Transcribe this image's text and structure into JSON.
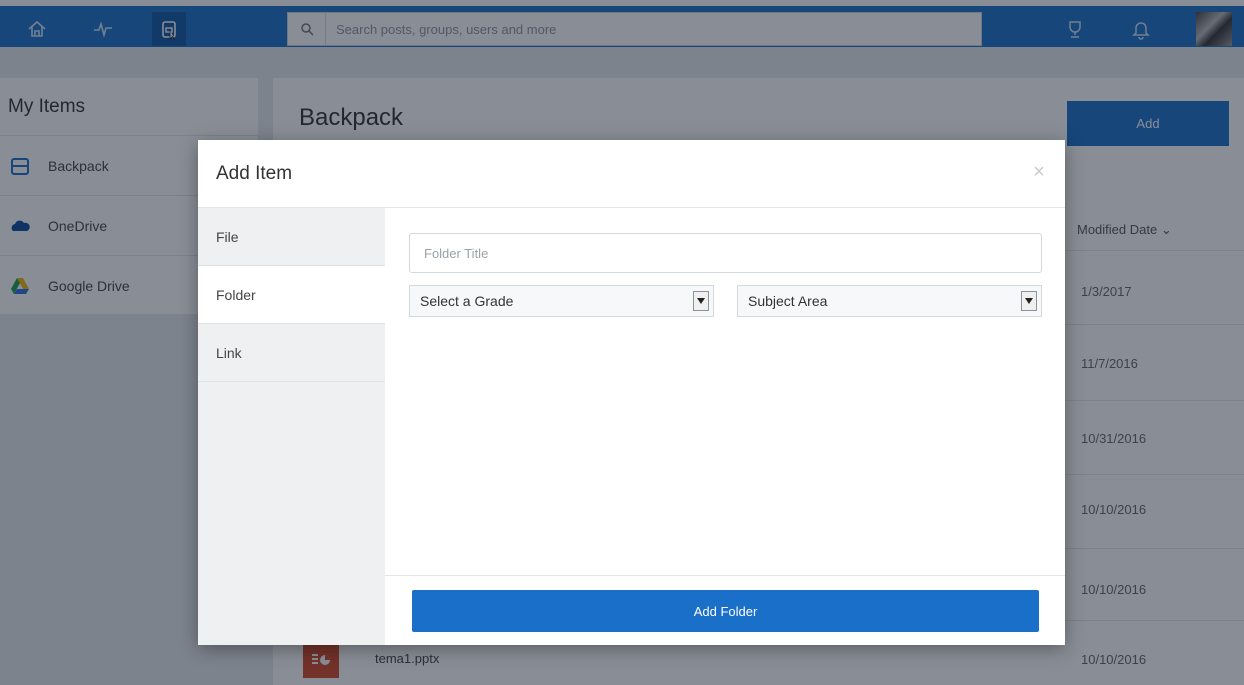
{
  "search": {
    "placeholder": "Search posts, groups, users and more"
  },
  "sidebar": {
    "title": "My Items",
    "items": [
      {
        "label": "Backpack",
        "icon": "backpack-icon"
      },
      {
        "label": "OneDrive",
        "icon": "cloud-icon"
      },
      {
        "label": "Google Drive",
        "icon": "google-drive-icon"
      }
    ]
  },
  "main": {
    "title": "Backpack",
    "add_label": "Add",
    "column_header": "Modified Date ⌄",
    "dates": [
      "1/3/2017",
      "11/7/2016",
      "10/31/2016",
      "10/10/2016",
      "10/10/2016",
      "10/10/2016"
    ],
    "file_name": "tema1.pptx"
  },
  "modal": {
    "title": "Add Item",
    "close": "×",
    "tabs": [
      "File",
      "Folder",
      "Link"
    ],
    "active_tab": "Folder",
    "folder_title_placeholder": "Folder Title",
    "grade_select": "Select a Grade",
    "subject_select": "Subject Area",
    "submit_label": "Add Folder"
  },
  "colors": {
    "brand": "#1a6fc9",
    "overlay": "rgba(20,30,45,0.5)",
    "pptx": "#d24726"
  }
}
